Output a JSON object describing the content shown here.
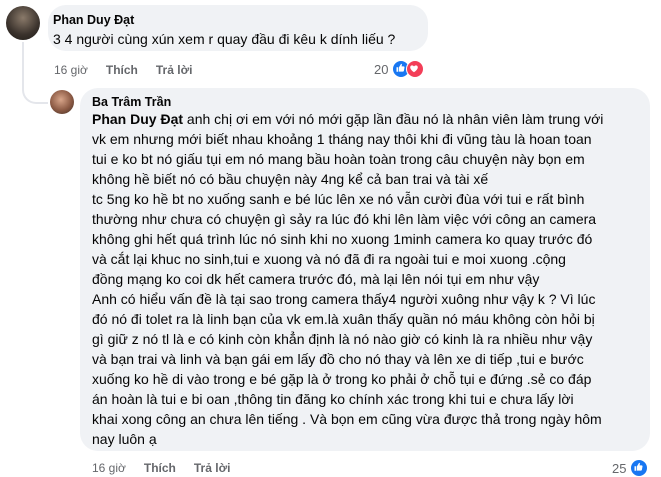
{
  "comment1": {
    "author": "Phan Duy Đạt",
    "text": "3 4 người cùng xún xem r quay đầu đi kêu k dính liếu ?",
    "time": "16 giờ",
    "like_label": "Thích",
    "reply_label": "Trả lời",
    "reaction_count": "20",
    "reactions": [
      "like-icon",
      "heart-icon"
    ]
  },
  "reply": {
    "author": "Ba Trâm Trần",
    "mention": "Phan Duy Đạt",
    "lines": [
      " anh chị ơi em với nó mới gặp lần đầu nó là nhân viên làm trung với",
      "vk em nhưng mới biết nhau khoảng 1 tháng nay thôi khi đi vũng tàu là hoan toan",
      "tui e ko bt nó giấu tụi em nó mang bầu hoàn toàn trong câu chuyện này bọn em",
      "không hề biết nó có bầu chuyện này 4ng kể cả ban trai và tài xế",
      "tc 5ng ko hề bt no xuống sanh e bé lúc lên xe nó vẫn cười đùa với tui e rất bình",
      "thường như chưa có chuyện gì sảy ra lúc đó khi lên làm việc với công an camera",
      "không ghi hết quá trình lúc nó sinh khi no xuong 1minh camera ko quay trước đó",
      "và cắt lại khuc no sinh,tui e xuong và nó đã đi ra ngoài tui e moi xuong .cộng",
      "đồng mạng ko coi dk hết camera trước đó, mà lại lên nói tụi em như vậy",
      "Anh có hiểu vấn đề là tại sao trong camera thấy4 người xuông như vậy k ? Vì lúc",
      "đó nó đi tolet ra là linh bạn của vk em.là xuân thấy quần nó máu không còn hỏi bị",
      "gì giữ z nó tl là e có kinh còn khẳn định là nó nào giờ có kinh là ra nhiều như vậy",
      "và bạn trai và linh và bạn gái em lấy đồ cho nó thay và lên xe di tiếp ,tui e bước",
      "xuống ko hề di vào trong e bé gặp là ở trong ko phải ở chỗ tụi e đứng .sẻ co đáp",
      "án hoàn là tui e bi oan ,thông tin đăng ko chính xác trong khi tui e chưa lấy lời",
      "khai xong công an chưa lên tiếng . Và bọn em cũng vừa được thả trong ngày hôm",
      "nay luôn ạ"
    ],
    "time": "16 giờ",
    "like_label": "Thích",
    "reply_label": "Trả lời",
    "reaction_count": "25",
    "reactions": [
      "like-icon"
    ]
  },
  "colors": {
    "bubble": "#f0f2f5",
    "like": "#1877f2",
    "heart": "#f33e58",
    "meta": "#65676b"
  }
}
